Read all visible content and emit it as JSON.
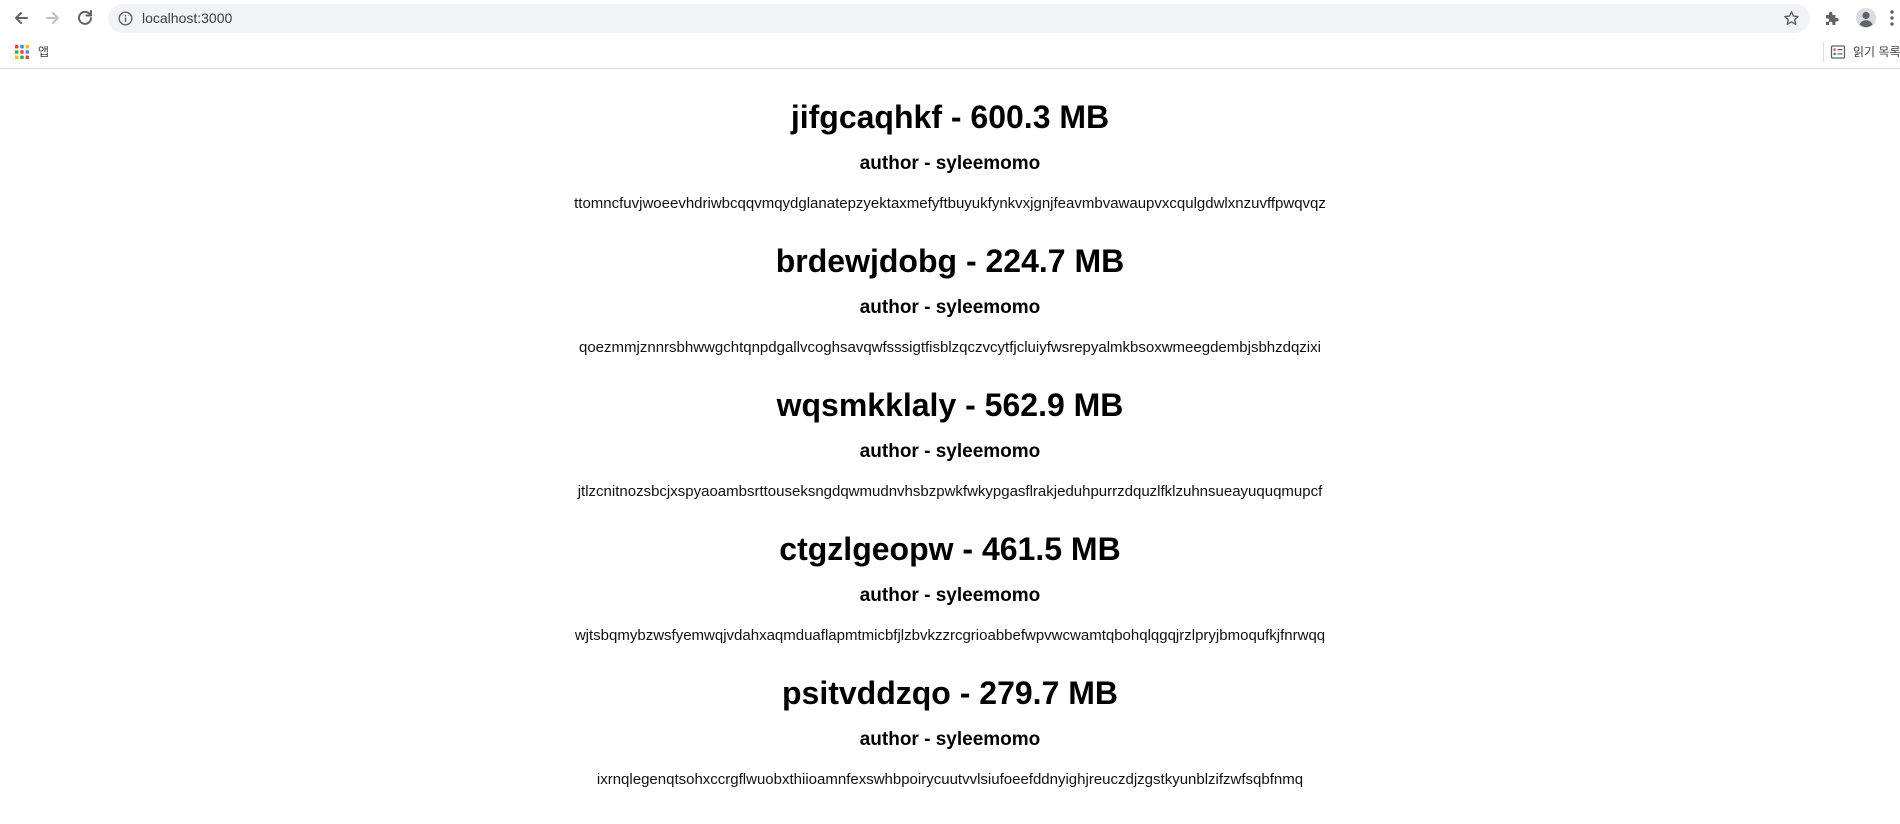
{
  "browser": {
    "url": "localhost:3000",
    "apps_label": "앱",
    "reading_list_label": "읽기 목록"
  },
  "posts": [
    {
      "title": "jifgcaqhkf - 600.3 MB",
      "author": "author - syleemomo",
      "body": "ttomncfuvjwoeevhdriwbcqqvmqydglanatepzyektaxmefyftbuyukfynkvxjgnjfeavmbvawaupvxcqulgdwlxnzuvffpwqvqz"
    },
    {
      "title": "brdewjdobg - 224.7 MB",
      "author": "author - syleemomo",
      "body": "qoezmmjznnrsbhwwgchtqnpdgallvcoghsavqwfsssigtfisblzqczvcytfjcluiyfwsrepyalmkbsoxwmeegdembjsbhzdqzixi"
    },
    {
      "title": "wqsmkklaly - 562.9 MB",
      "author": "author - syleemomo",
      "body": "jtlzcnitnozsbcjxspyaoambsrttouseksngdqwmudnvhsbzpwkfwkypgasflrakjeduhpurrzdquzlfklzuhnsueayuquqmupcf"
    },
    {
      "title": "ctgzlgeopw - 461.5 MB",
      "author": "author - syleemomo",
      "body": "wjtsbqmybzwsfyemwqjvdahxaqmduaflapmtmicbfjlzbvkzzrcgrioabbefwpvwcwamtqbohqlqgqjrzlpryjbmoqufkjfnrwqq"
    },
    {
      "title": "psitvddzqo - 279.7 MB",
      "author": "author - syleemomo",
      "body": "ixrnqlegenqtsohxccrgflwuobxthiioamnfexswhbpoirycuutvvlsiufoeefddnyighjreuczdjzgstkyunblzifzwfsqbfnmq"
    }
  ]
}
